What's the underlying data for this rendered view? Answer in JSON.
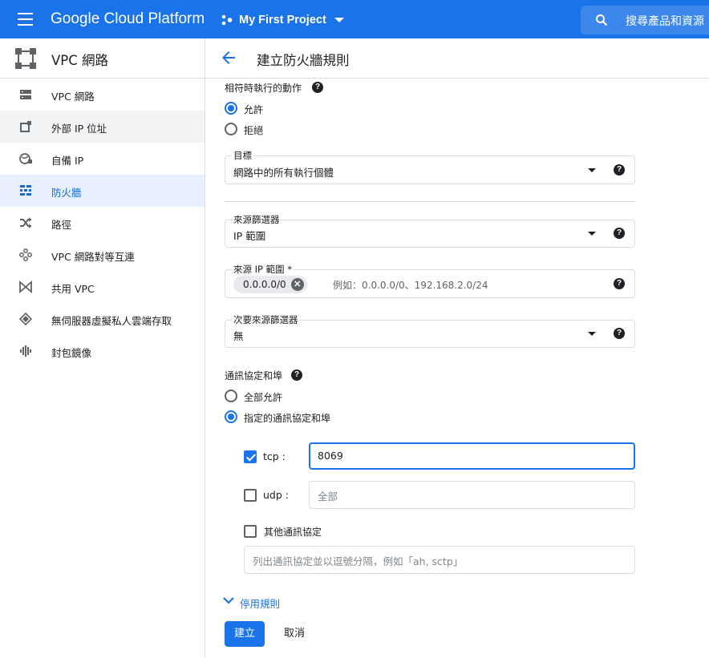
{
  "topbar": {
    "brand": "Google Cloud Platform",
    "project": "My First Project",
    "search_placeholder": "搜尋產品和資源"
  },
  "sidebar": {
    "title": "VPC 網路",
    "items": [
      {
        "label": "VPC 網路",
        "icon": "vpc-network-icon"
      },
      {
        "label": "外部 IP 位址",
        "icon": "external-ip-icon"
      },
      {
        "label": "自備 IP",
        "icon": "byoip-globe-icon"
      },
      {
        "label": "防火牆",
        "icon": "firewall-icon"
      },
      {
        "label": "路徑",
        "icon": "routes-icon"
      },
      {
        "label": "VPC 網路對等互連",
        "icon": "peering-icon"
      },
      {
        "label": "共用 VPC",
        "icon": "shared-vpc-icon"
      },
      {
        "label": "無伺服器虛擬私人雲端存取",
        "icon": "serverless-vpc-icon"
      },
      {
        "label": "封包鏡像",
        "icon": "packet-mirroring-icon"
      }
    ]
  },
  "page": {
    "title": "建立防火牆規則"
  },
  "form": {
    "action_label": "相符時執行的動作",
    "action_options": [
      "允許",
      "拒絕"
    ],
    "action_selected": "允許",
    "target_label": "目標",
    "target_value": "網路中的所有執行個體",
    "source_filter_label": "來源篩選器",
    "source_filter_value": "IP 範圍",
    "source_ip_label": "來源 IP 範圍 *",
    "source_ip_chip": "0.0.0.0/0",
    "source_ip_hint": "例如：0.0.0.0/0、192.168.2.0/24",
    "second_filter_label": "次要來源篩選器",
    "second_filter_value": "無",
    "protocols_label": "通訊協定和埠",
    "protocol_options": [
      "全部允許",
      "指定的通訊協定和埠"
    ],
    "protocol_selected": "指定的通訊協定和埠",
    "tcp_label": "tcp :",
    "tcp_checked": true,
    "tcp_value": "8069",
    "udp_label": "udp :",
    "udp_checked": false,
    "udp_placeholder": "全部",
    "other_label": "其他通訊協定",
    "other_checked": false,
    "other_placeholder": "列出通訊協定並以逗號分隔，例如「ah, sctp」",
    "disable_rule_link": "停用規則",
    "help_glyph": "?",
    "chip_remove_glyph": "✕"
  },
  "actions": {
    "create": "建立",
    "cancel": "取消"
  },
  "colors": {
    "brand_blue": "#1a73e8",
    "active_bg": "#e8f0fe"
  }
}
